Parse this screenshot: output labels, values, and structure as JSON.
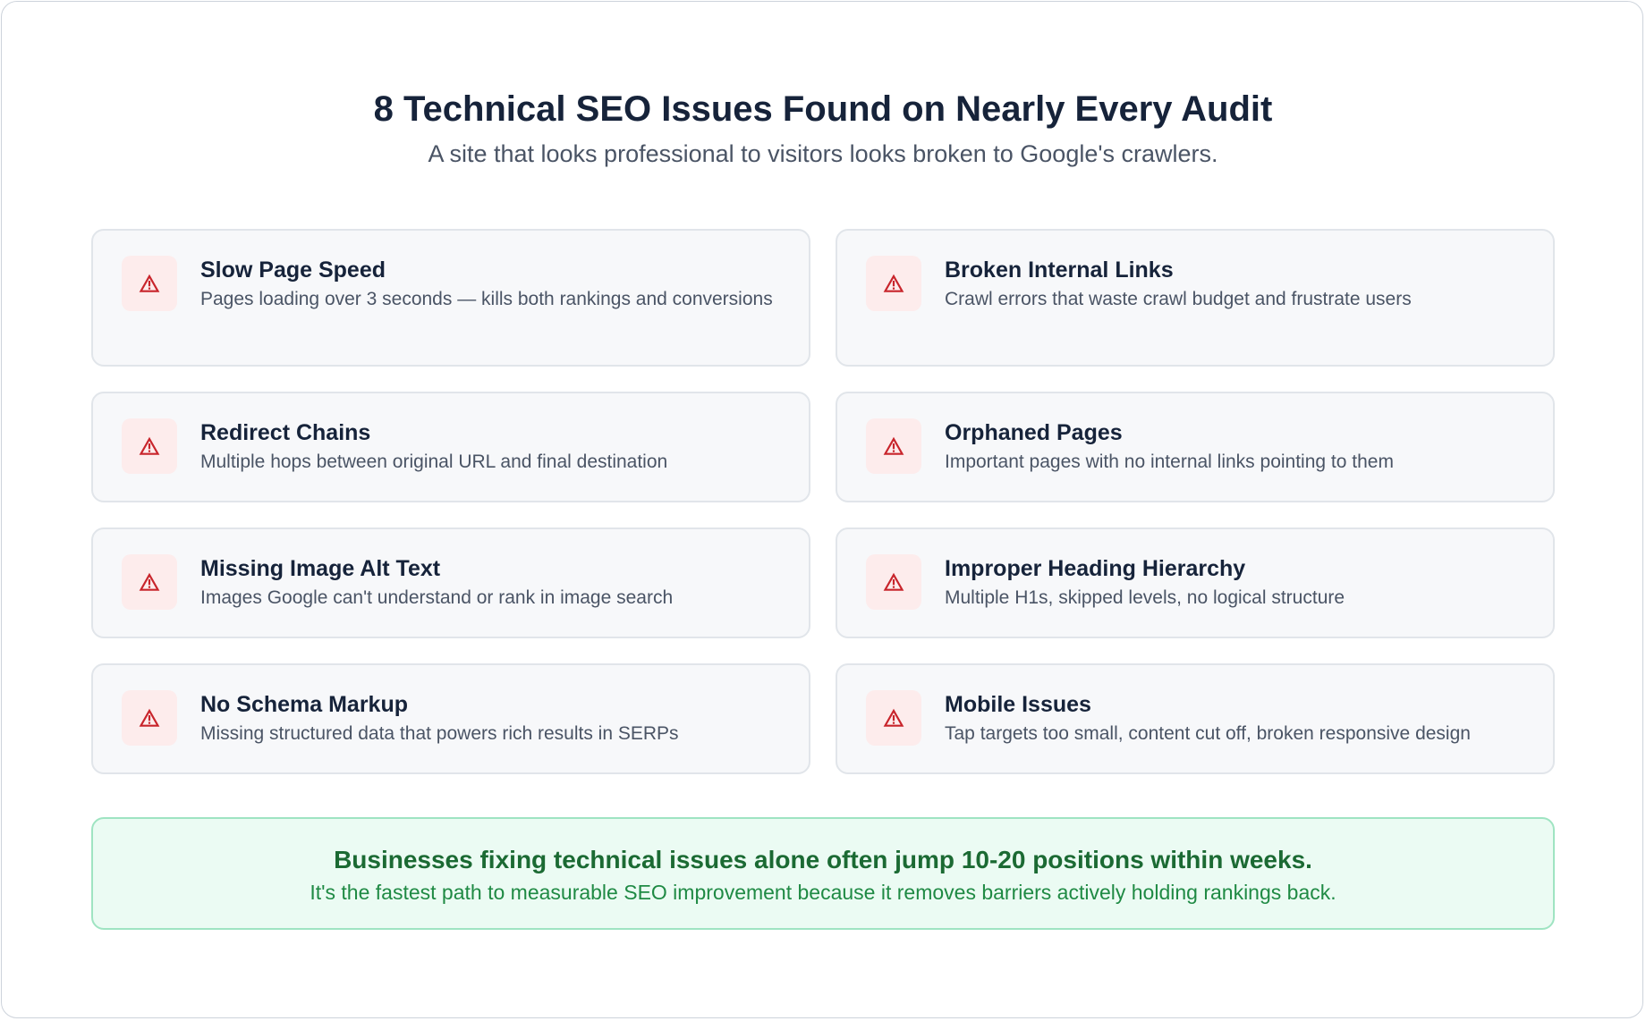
{
  "header": {
    "title": "8 Technical SEO Issues Found on Nearly Every Audit",
    "subtitle": "A site that looks professional to visitors looks broken to Google's crawlers."
  },
  "issues": [
    {
      "icon": "warning-icon",
      "title": "Slow Page Speed",
      "description": "Pages loading over 3 seconds — kills both rankings and conversions"
    },
    {
      "icon": "warning-icon",
      "title": "Broken Internal Links",
      "description": "Crawl errors that waste crawl budget and frustrate users"
    },
    {
      "icon": "warning-icon",
      "title": "Redirect Chains",
      "description": "Multiple hops between original URL and final destination"
    },
    {
      "icon": "warning-icon",
      "title": "Orphaned Pages",
      "description": "Important pages with no internal links pointing to them"
    },
    {
      "icon": "warning-icon",
      "title": "Missing Image Alt Text",
      "description": "Images Google can't understand or rank in image search"
    },
    {
      "icon": "warning-icon",
      "title": "Improper Heading Hierarchy",
      "description": "Multiple H1s, skipped levels, no logical structure"
    },
    {
      "icon": "warning-icon",
      "title": "No Schema Markup",
      "description": "Missing structured data that powers rich results in SERPs"
    },
    {
      "icon": "warning-icon",
      "title": "Mobile Issues",
      "description": "Tap targets too small, content cut off, broken responsive design"
    }
  ],
  "callout": {
    "title": "Businesses fixing technical issues alone often jump 10-20 positions within weeks.",
    "description": "It's the fastest path to measurable SEO improvement because it removes barriers actively holding rankings back."
  },
  "colors": {
    "heading": "#16233a",
    "body_text": "#4a5465",
    "warning": "#c8242b",
    "warning_bg": "#fdecec",
    "card_bg": "#f7f8fa",
    "callout_bg": "#ebfbf3",
    "callout_border": "#9fe4c2",
    "callout_title": "#1b6a33",
    "callout_text": "#1f8a44"
  }
}
